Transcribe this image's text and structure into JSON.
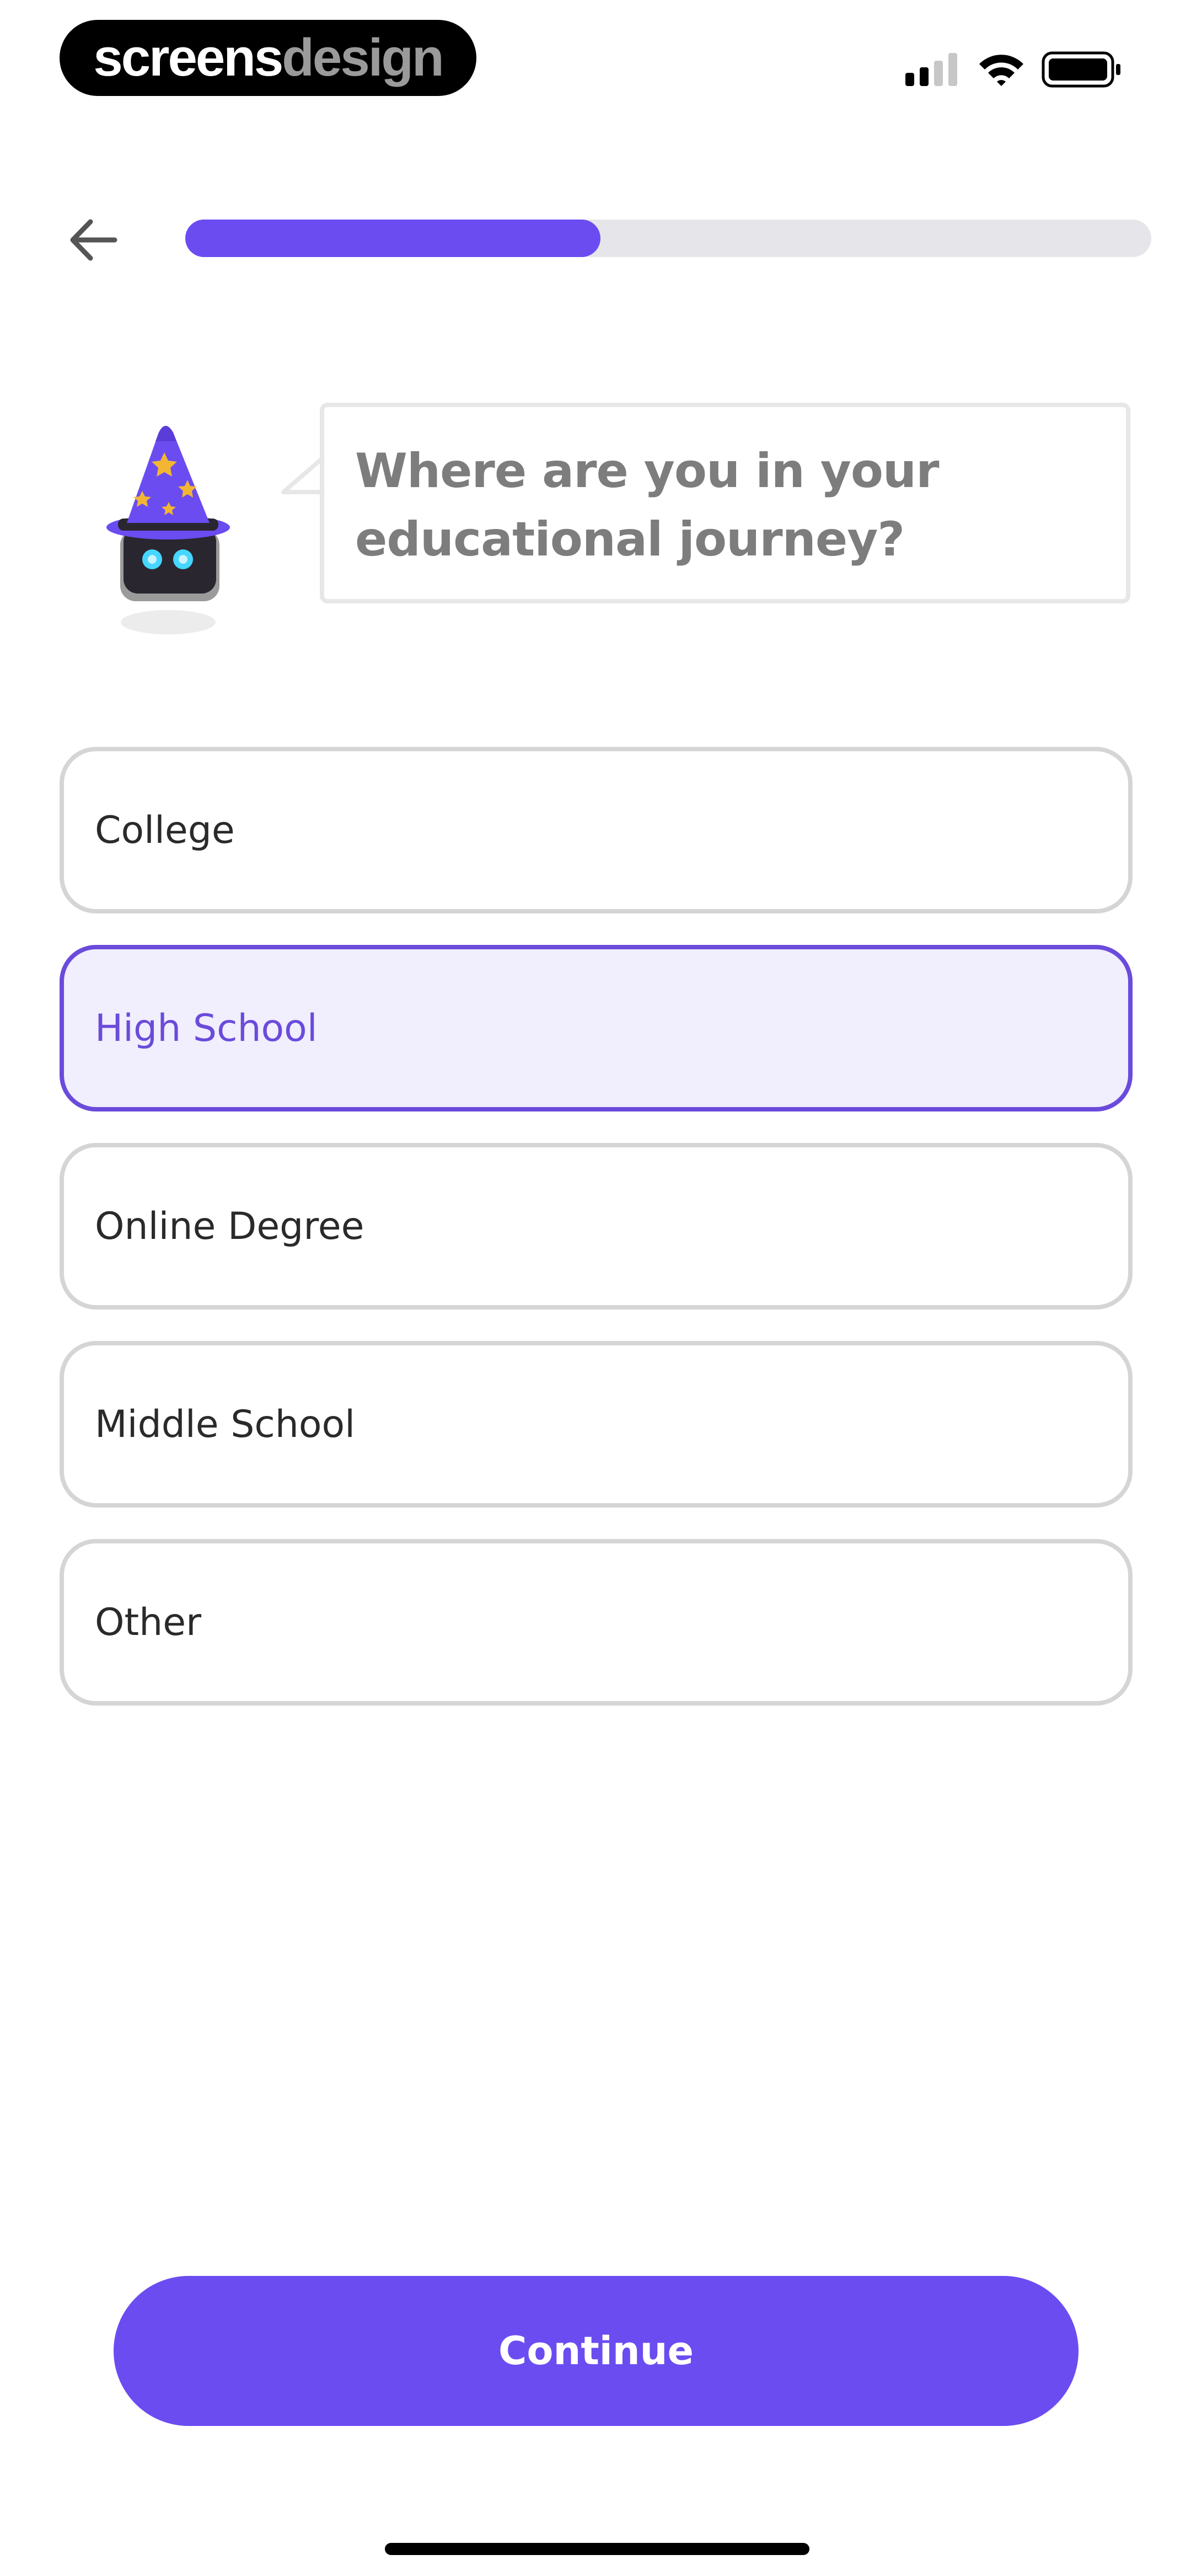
{
  "status_bar": {
    "brand_part1": "screens",
    "brand_part2": "design",
    "icons": [
      "signal-icon",
      "wifi-icon",
      "battery-icon"
    ]
  },
  "header": {
    "back_icon": "arrow-left-icon",
    "progress_fraction": 0.43
  },
  "prompt": {
    "question": "Where are you in your educational journey?"
  },
  "options": [
    {
      "label": "College",
      "selected": false
    },
    {
      "label": "High School",
      "selected": true
    },
    {
      "label": "Online Degree",
      "selected": false
    },
    {
      "label": "Middle School",
      "selected": false
    },
    {
      "label": "Other",
      "selected": false
    }
  ],
  "footer": {
    "continue_label": "Continue"
  },
  "colors": {
    "accent": "#6b4cf1",
    "selected_border": "#6a4bdb",
    "selected_bg": "#f1eefd",
    "option_border": "#d5d5d5",
    "progress_track": "#e6e5e9",
    "question_text": "#7d7d7d"
  }
}
